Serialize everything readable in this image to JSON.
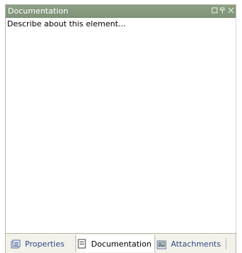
{
  "panel": {
    "title": "Documentation",
    "buttons": {
      "minimize_icon": "minimize-icon",
      "pin_icon": "pin-icon",
      "close_icon": "close-icon"
    }
  },
  "editor": {
    "text": "Describe about this element..."
  },
  "tabs": [
    {
      "label": "Properties",
      "icon": "properties-icon"
    },
    {
      "label": "Documentation",
      "icon": "documentation-icon"
    },
    {
      "label": "Attachments",
      "icon": "attachments-icon"
    }
  ],
  "colors": {
    "titlebar": "#8e9f84",
    "tab_inactive_text": "#314a86"
  }
}
